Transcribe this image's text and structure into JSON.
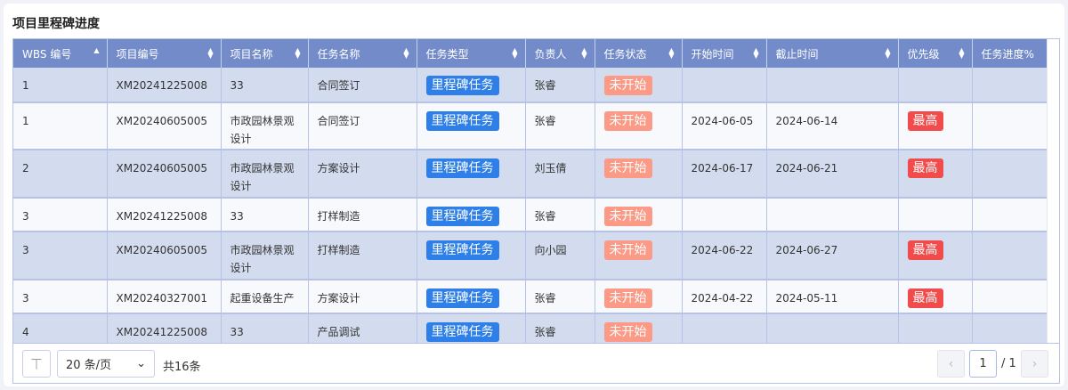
{
  "title": "项目里程碑进度",
  "colors": {
    "header": "#738bc8",
    "milestone": "#2f7fe8",
    "not_started": "#fb9a86",
    "highest": "#f24b4b"
  },
  "columns": [
    {
      "label": "WBS 编号",
      "sort": "asc"
    },
    {
      "label": "项目编号",
      "sort": "both"
    },
    {
      "label": "项目名称",
      "sort": "both"
    },
    {
      "label": "任务名称",
      "sort": "both"
    },
    {
      "label": "任务类型",
      "sort": "both"
    },
    {
      "label": "负责人",
      "sort": "both"
    },
    {
      "label": "任务状态",
      "sort": "both"
    },
    {
      "label": "开始时间",
      "sort": "both"
    },
    {
      "label": "截止时间",
      "sort": "both"
    },
    {
      "label": "优先级",
      "sort": "both"
    },
    {
      "label": "任务进度%",
      "sort": ""
    }
  ],
  "rows": [
    [
      "1",
      "XM20241225008",
      "33",
      "合同签订",
      "里程碑任务",
      "张睿",
      "未开始",
      "",
      "",
      "",
      ""
    ],
    [
      "1",
      "XM20240605005",
      "市政园林景观设计",
      "合同签订",
      "里程碑任务",
      "张睿",
      "未开始",
      "2024-06-05",
      "2024-06-14",
      "最高",
      ""
    ],
    [
      "2",
      "XM20240605005",
      "市政园林景观设计",
      "方案设计",
      "里程碑任务",
      "刘玉倩",
      "未开始",
      "2024-06-17",
      "2024-06-21",
      "最高",
      ""
    ],
    [
      "3",
      "XM20241225008",
      "33",
      "打样制造",
      "里程碑任务",
      "张睿",
      "未开始",
      "",
      "",
      "",
      ""
    ],
    [
      "3",
      "XM20240605005",
      "市政园林景观设计",
      "打样制造",
      "里程碑任务",
      "向小园",
      "未开始",
      "2024-06-22",
      "2024-06-27",
      "最高",
      ""
    ],
    [
      "3",
      "XM20240327001",
      "起重设备生产",
      "方案设计",
      "里程碑任务",
      "张睿",
      "未开始",
      "2024-04-22",
      "2024-05-11",
      "最高",
      ""
    ],
    [
      "4",
      "XM20241225008",
      "33",
      "产品调试",
      "里程碑任务",
      "张睿",
      "未开始",
      "",
      "",
      "",
      ""
    ]
  ],
  "footer": {
    "page_size": "20 条/页",
    "total": "共16条",
    "page": "1",
    "of": "/ 1",
    "prev": "‹",
    "next": "›",
    "first_icon": "⏉"
  }
}
